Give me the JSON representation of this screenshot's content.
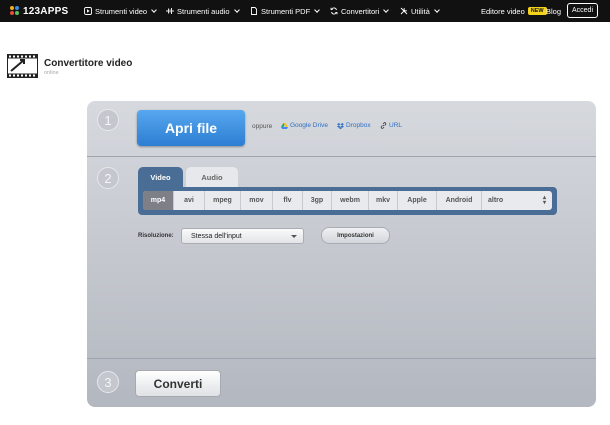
{
  "topbar": {
    "logo": "123APPS",
    "nav": [
      {
        "label": "Strumenti video",
        "icon": "play-icon"
      },
      {
        "label": "Strumenti audio",
        "icon": "waveform-icon"
      },
      {
        "label": "Strumenti PDF",
        "icon": "document-icon"
      },
      {
        "label": "Convertitori",
        "icon": "convert-icon"
      },
      {
        "label": "Utilità",
        "icon": "tools-icon"
      }
    ],
    "editor_label": "Editore video",
    "editor_badge": "NEW",
    "blog_label": "Blog",
    "login_label": "Accedi"
  },
  "page": {
    "title": "Convertitore video",
    "subtitle": "online"
  },
  "step1": {
    "number": "1",
    "open_label": "Apri file",
    "or_label": "oppure",
    "sources": [
      {
        "label": "Google Drive",
        "icon": "google-drive-icon"
      },
      {
        "label": "Dropbox",
        "icon": "dropbox-icon"
      },
      {
        "label": "URL",
        "icon": "link-icon"
      }
    ]
  },
  "step2": {
    "number": "2",
    "tabs": [
      {
        "label": "Video",
        "active": true
      },
      {
        "label": "Audio",
        "active": false
      }
    ],
    "formats": [
      "mp4",
      "avi",
      "mpeg",
      "mov",
      "flv",
      "3gp",
      "webm",
      "mkv",
      "Apple",
      "Android"
    ],
    "active_format": "mp4",
    "more_label": "altro",
    "resolution_label": "Risoluzione:",
    "resolution_value": "Stessa dell'input",
    "settings_label": "Impostazioni"
  },
  "step3": {
    "number": "3",
    "convert_label": "Converti"
  },
  "colors": {
    "topbar_bg": "#111111",
    "primary_button": "#3a8ae0",
    "tab_active": "#4a6d95",
    "link": "#2f6fc4",
    "badge": "#f5d21c"
  }
}
